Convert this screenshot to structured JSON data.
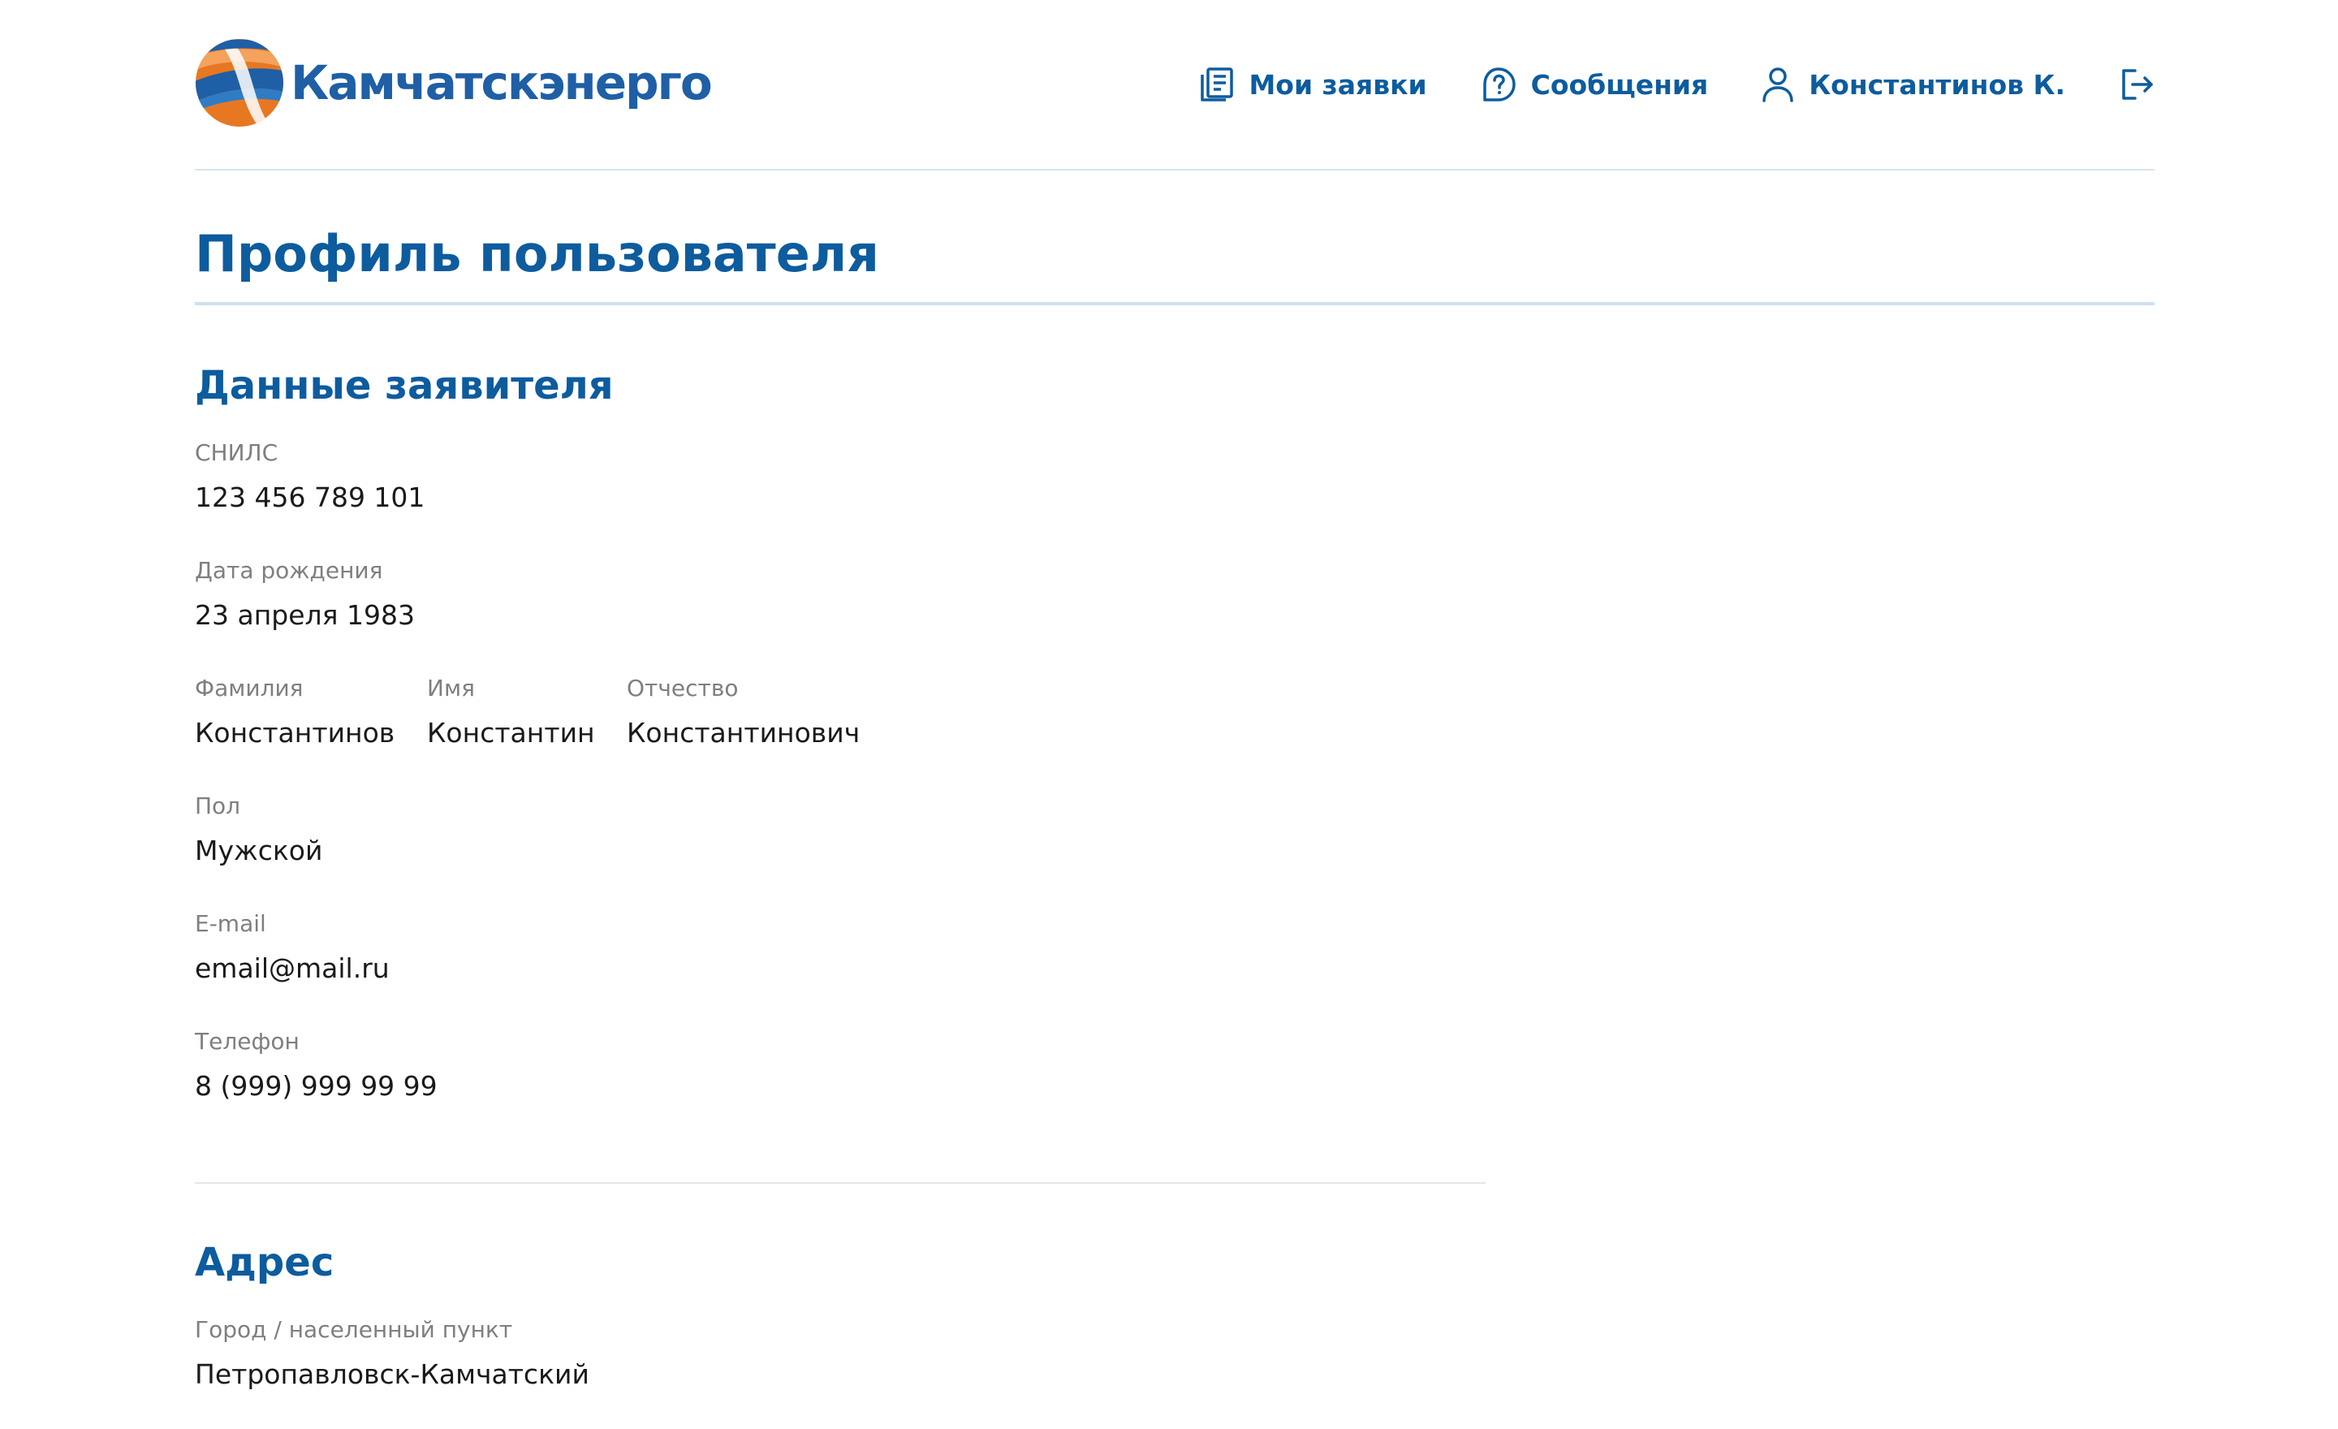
{
  "header": {
    "logo_text": "Камчатскэнерго",
    "nav": {
      "requests_label": "Мои заявки",
      "messages_label": "Сообщения",
      "user_label": "Константинов К."
    }
  },
  "page": {
    "title": "Профиль пользователя"
  },
  "applicant": {
    "title": "Данные заявителя",
    "snils_label": "СНИЛС",
    "snils_value": "123 456 789 101",
    "birth_label": "Дата рождения",
    "birth_value": "23 апреля 1983",
    "surname_label": "Фамилия",
    "surname_value": "Константинов",
    "name_label": "Имя",
    "name_value": "Константин",
    "patronymic_label": "Отчество",
    "patronymic_value": "Константинович",
    "gender_label": "Пол",
    "gender_value": "Мужской",
    "email_label": "E-mail",
    "email_value": "email@mail.ru",
    "phone_label": "Телефон",
    "phone_value": "8 (999) 999 99 99"
  },
  "address": {
    "title": "Адрес",
    "city_label": "Город / населенный пункт",
    "city_value": "Петропавловск-Камчатский"
  },
  "colors": {
    "accent": "#0d5c9e",
    "logo_blue": "#1f5fa6",
    "logo_orange": "#e87722",
    "label": "#7f7f7f",
    "text": "#1a1a1a",
    "divider": "#cfe0f1"
  },
  "icons": {
    "logo": "kamchatskenergo-logo-icon",
    "requests": "document-list-icon",
    "messages": "question-bubble-icon",
    "user": "user-icon",
    "logout": "logout-icon"
  }
}
